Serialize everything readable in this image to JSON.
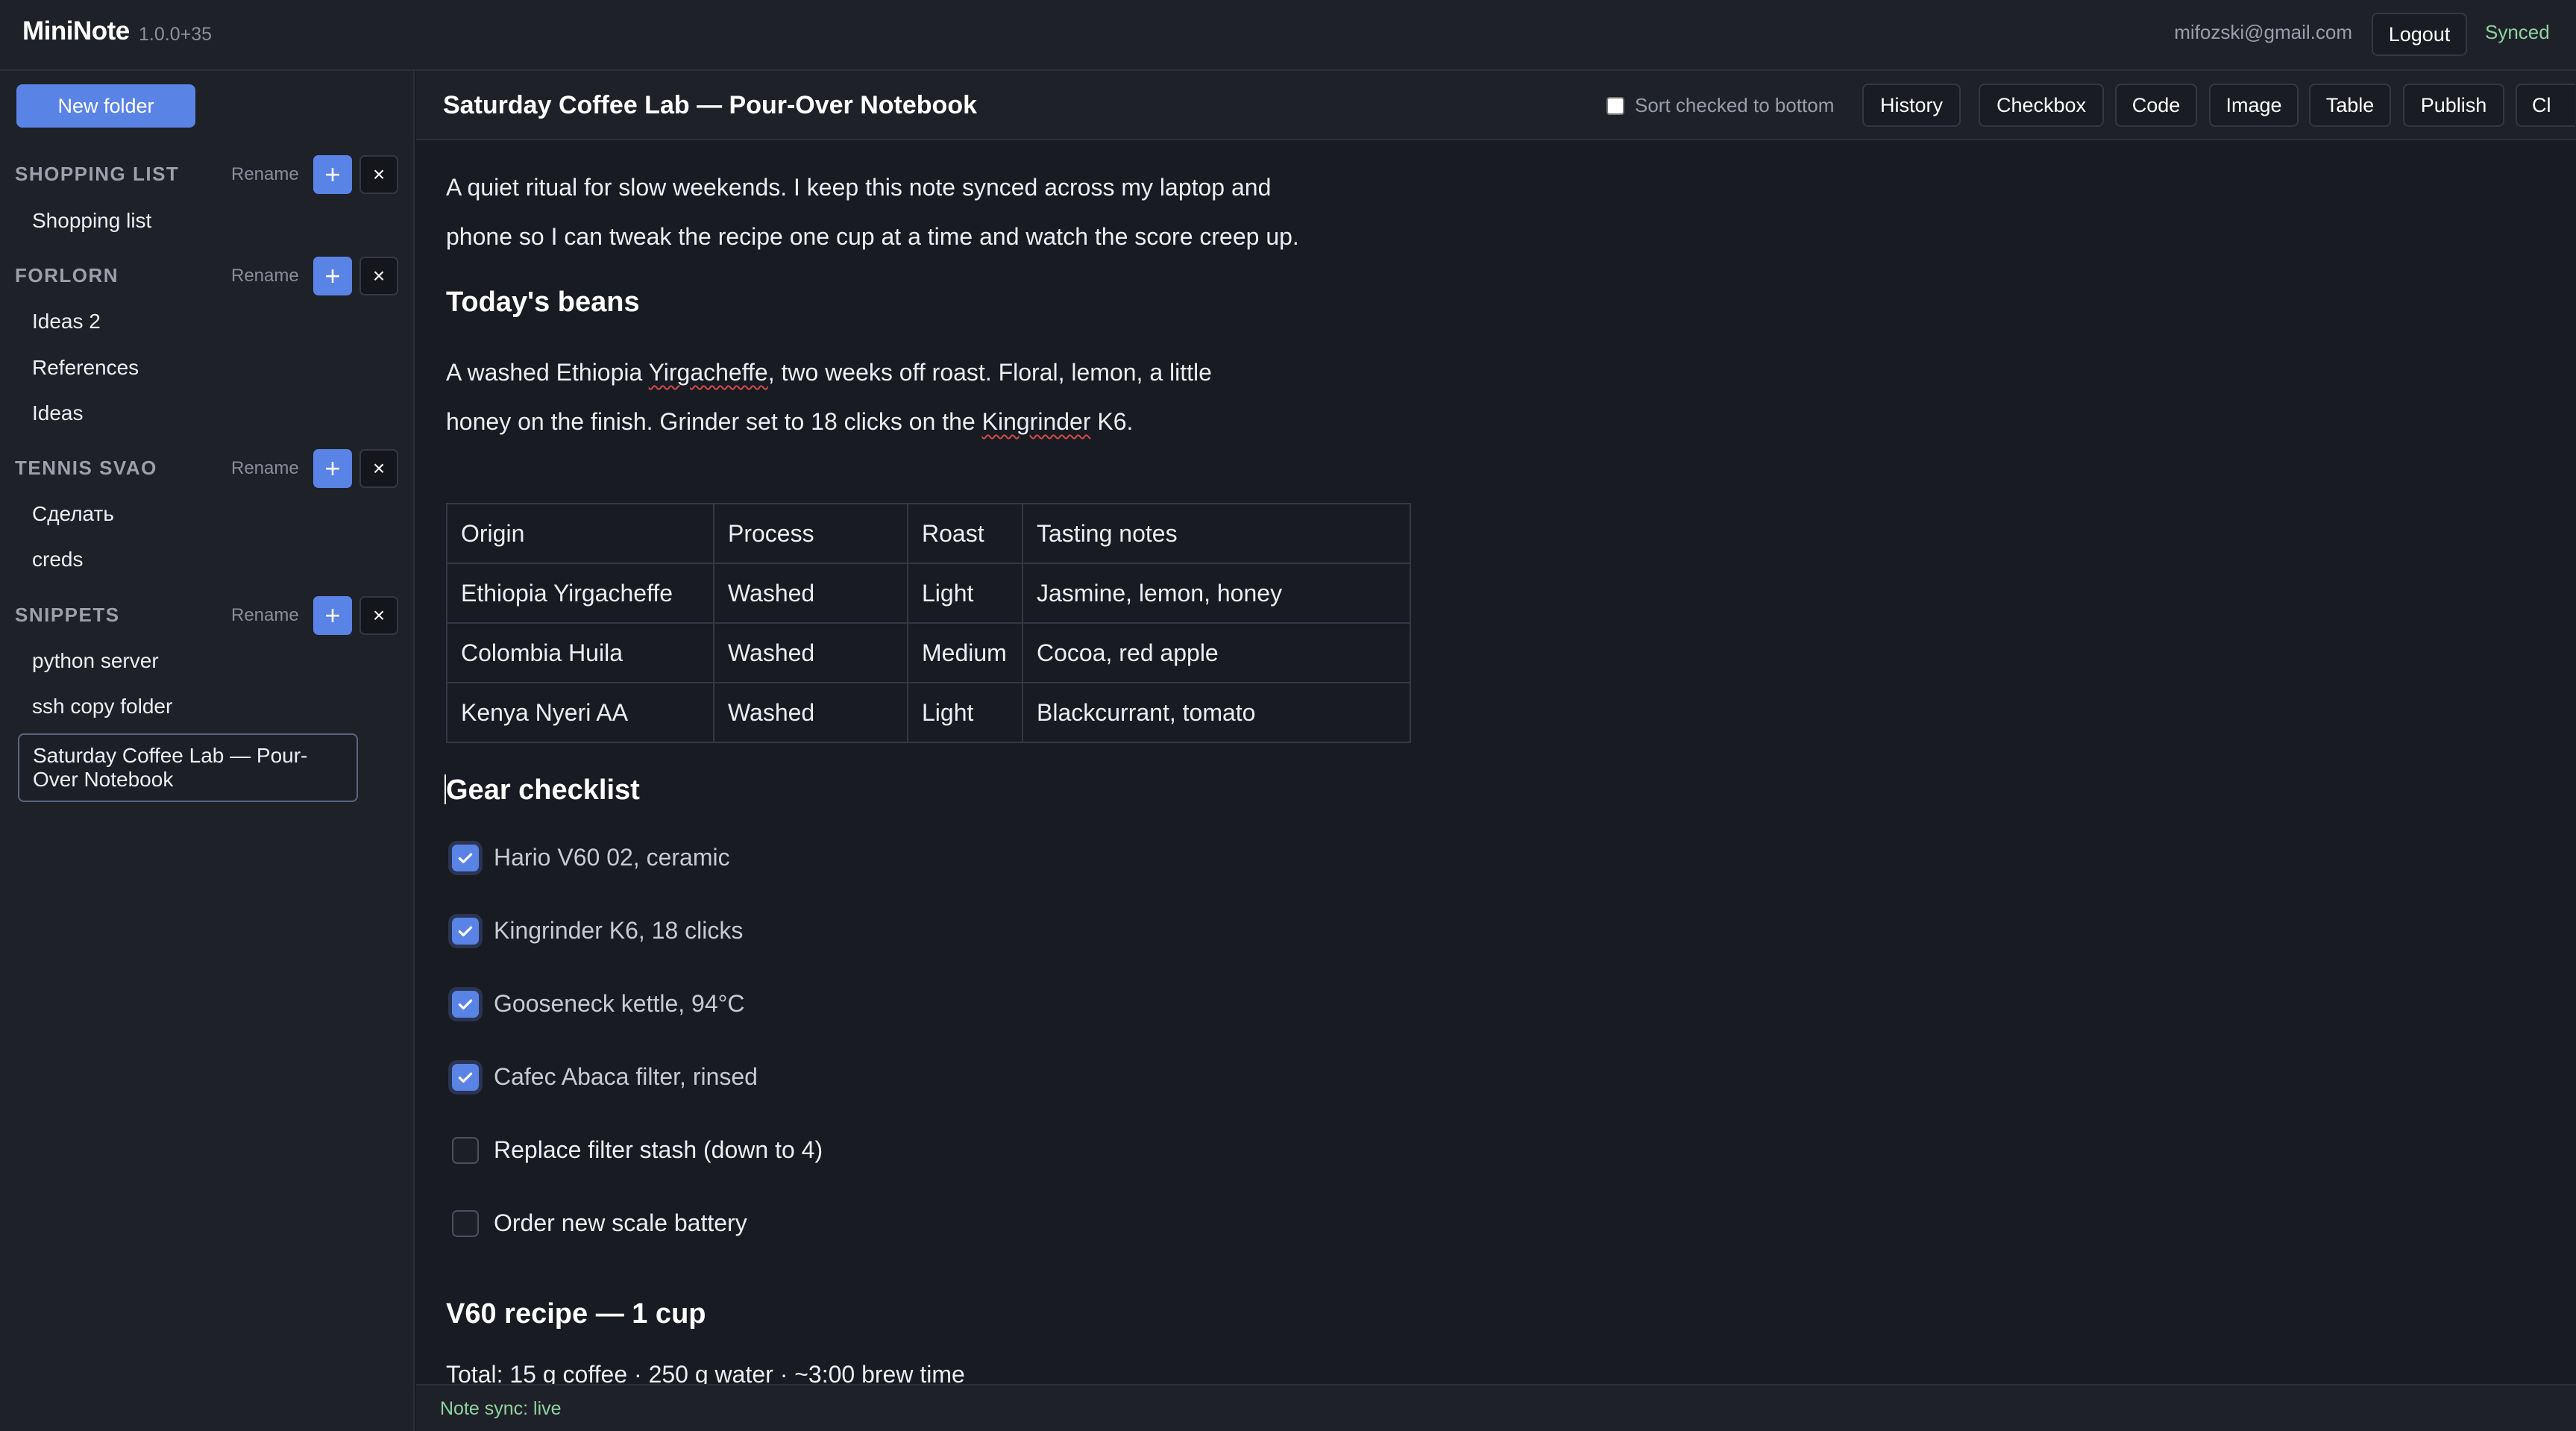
{
  "header": {
    "app_name": "MiniNote",
    "app_version": "1.0.0+35",
    "user_email": "mifozski@gmail.com",
    "logout_label": "Logout",
    "sync_status": "Synced"
  },
  "sidebar": {
    "new_folder_label": "New folder",
    "rename_label": "Rename",
    "add_icon": "+",
    "delete_icon": "×",
    "folders": [
      {
        "title": "SHOPPING LIST",
        "notes": [
          "Shopping list"
        ]
      },
      {
        "title": "FORLORN",
        "notes": [
          "Ideas 2",
          "References",
          "Ideas"
        ]
      },
      {
        "title": "TENNIS SVAO",
        "notes": [
          "Сделать",
          "creds"
        ]
      },
      {
        "title": "SNIPPETS",
        "notes": [
          "python server",
          "ssh copy folder",
          "Saturday Coffee Lab — Pour-Over Notebook"
        ]
      }
    ]
  },
  "editor": {
    "title": "Saturday Coffee Lab — Pour-Over Notebook",
    "sort_checked_label": "Sort checked to bottom",
    "sort_checked": false,
    "toolbar": {
      "history": "History",
      "checkbox": "Checkbox",
      "code": "Code",
      "image": "Image",
      "table": "Table",
      "publish": "Publish",
      "clipped": "Cl"
    },
    "intro": {
      "line1": "A quiet ritual for slow weekends. I keep this note synced across my laptop and",
      "line2": "phone so I can tweak the recipe one cup at a time and watch the score creep up."
    },
    "beans_heading": "Today's beans",
    "beans": {
      "l1a": "A washed Ethiopia ",
      "l1b": "Yirgacheffe",
      "l1c": ", two weeks off roast. Floral, lemon, a little",
      "l2a": "honey on the finish. Grinder set to 18 clicks on the ",
      "l2b": "Kingrinder",
      "l2c": " K6."
    },
    "table": {
      "headers": [
        "Origin",
        "Process",
        "Roast",
        "Tasting notes"
      ],
      "rows": [
        [
          "Ethiopia Yirgacheffe",
          "Washed",
          "Light",
          "Jasmine, lemon, honey"
        ],
        [
          "Colombia Huila",
          "Washed",
          "Medium",
          "Cocoa, red apple"
        ],
        [
          "Kenya Nyeri AA",
          "Washed",
          "Light",
          "Blackcurrant, tomato"
        ]
      ]
    },
    "gear_heading": "Gear checklist",
    "checklist": [
      {
        "label": "Hario V60 02, ceramic",
        "checked": true
      },
      {
        "label": "Kingrinder K6, 18 clicks",
        "checked": true
      },
      {
        "label": "Gooseneck kettle, 94°C",
        "checked": true
      },
      {
        "label": "Cafec Abaca filter, rinsed",
        "checked": true
      },
      {
        "label": "Replace filter stash (down to 4)",
        "checked": false
      },
      {
        "label": "Order new scale battery",
        "checked": false
      }
    ],
    "recipe_heading": "V60 recipe — 1 cup",
    "recipe_partial": "Total: 15 g coffee · 250 g water · ~3:00 brew time"
  },
  "footer": {
    "status": "Note sync: live"
  },
  "colors": {
    "accent": "#5a83e6",
    "sync_green": "#8fd39f",
    "background": "#191b22"
  }
}
